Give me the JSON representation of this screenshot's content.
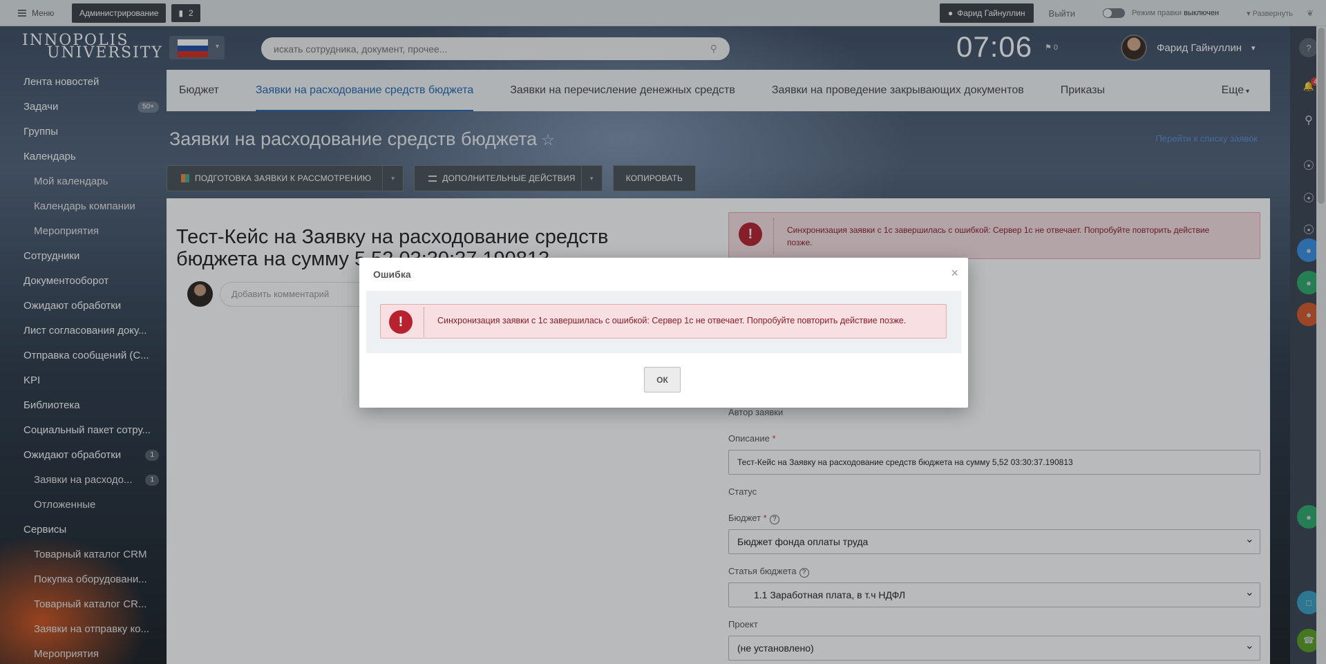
{
  "topbar": {
    "menu_label": "Меню",
    "admin_label": "Администрирование",
    "notes_count": "2",
    "user_name": "Фарид Гайнуллин",
    "logout_label": "Выйти",
    "edit_mode_label": "Режим правки",
    "edit_mode_state": "выключен",
    "expand_label": "Развернуть"
  },
  "header": {
    "logo_line1": "INNOPOLIS",
    "logo_line2": "UNIVERSITY",
    "search_placeholder": "искать сотрудника, документ, прочее...",
    "time": "07:06",
    "flag_count": "0",
    "user_name": "Фарид Гайнуллин"
  },
  "right_sidebar": {
    "notifications_count": "44"
  },
  "left_menu": [
    {
      "label": "Лента новостей",
      "sub": false,
      "count": ""
    },
    {
      "label": "Задачи",
      "sub": false,
      "count": "50+"
    },
    {
      "label": "Группы",
      "sub": false,
      "count": ""
    },
    {
      "label": "Календарь",
      "sub": false,
      "count": ""
    },
    {
      "label": "Мой календарь",
      "sub": true,
      "count": ""
    },
    {
      "label": "Календарь компании",
      "sub": true,
      "count": ""
    },
    {
      "label": "Мероприятия",
      "sub": true,
      "count": ""
    },
    {
      "label": "Сотрудники",
      "sub": false,
      "count": ""
    },
    {
      "label": "Документооборот",
      "sub": false,
      "count": ""
    },
    {
      "label": "Ожидают обработки",
      "sub": false,
      "count": ""
    },
    {
      "label": "Лист согласования доку...",
      "sub": false,
      "count": ""
    },
    {
      "label": "Отправка сообщений (С...",
      "sub": false,
      "count": ""
    },
    {
      "label": "KPI",
      "sub": false,
      "count": ""
    },
    {
      "label": "Библиотека",
      "sub": false,
      "count": ""
    },
    {
      "label": "Социальный пакет сотру...",
      "sub": false,
      "count": ""
    },
    {
      "label": "Ожидают обработки",
      "sub": false,
      "count": "1"
    },
    {
      "label": "Заявки на расходо...",
      "sub": true,
      "count": "1"
    },
    {
      "label": "Отложенные",
      "sub": true,
      "count": ""
    },
    {
      "label": "Сервисы",
      "sub": false,
      "count": ""
    },
    {
      "label": "Товарный каталог CRM",
      "sub": true,
      "count": ""
    },
    {
      "label": "Покупка оборудовани...",
      "sub": true,
      "count": ""
    },
    {
      "label": "Товарный каталог CR...",
      "sub": true,
      "count": ""
    },
    {
      "label": "Заявки на отправку ко...",
      "sub": true,
      "count": ""
    },
    {
      "label": "Мероприятия",
      "sub": true,
      "count": ""
    }
  ],
  "tabs": [
    {
      "label": "Бюджет",
      "active": false
    },
    {
      "label": "Заявки на расходование средств бюджета",
      "active": true
    },
    {
      "label": "Заявки на перечисление денежных средств",
      "active": false
    },
    {
      "label": "Заявки на проведение закрывающих документов",
      "active": false
    },
    {
      "label": "Приказы",
      "active": false
    },
    {
      "label": "Еще",
      "active": false
    }
  ],
  "page": {
    "title": "Заявки на расходование средств бюджета",
    "go_to_list": "Перейти к списку заявок",
    "actions": {
      "prepare": "Подготовка заявки к рассмотрению",
      "more": "Дополнительные действия",
      "copy": "Копировать"
    }
  },
  "document": {
    "title": "Тест-Кейс на Заявку на расходование средств бюджета на сумму 5,52 03:30:37.190813",
    "comment_placeholder": "Добавить комментарий",
    "error_text": "Синхронизация заявки с 1с завершилась с ошибкой: Сервер 1с не отвечает. Попробуйте повторить действие позже.",
    "form": {
      "author_label": "Автор заявки",
      "description_label": "Описание",
      "description_value": "Тест-Кейс на Заявку на расходование средств бюджета на сумму 5,52 03:30:37.190813",
      "status_label": "Статус",
      "budget_label": "Бюджет",
      "budget_value": "Бюджет фонда оплаты труда",
      "article_label": "Статья бюджета",
      "article_value": "1.1  Заработная плата, в т.ч  НДФЛ",
      "project_label": "Проект",
      "project_value": "(не установлено)"
    }
  },
  "modal": {
    "title": "Ошибка",
    "message": "Синхронизация заявки с 1с завершилась с ошибкой: Сервер 1с не отвечает. Попробуйте повторить действие позже.",
    "ok_label": "ОК"
  },
  "colors": {
    "accent": "#2068b5",
    "error_bg": "#f8e0e2",
    "error_text": "#8a1c2a",
    "error_icon": "#b8212f"
  }
}
